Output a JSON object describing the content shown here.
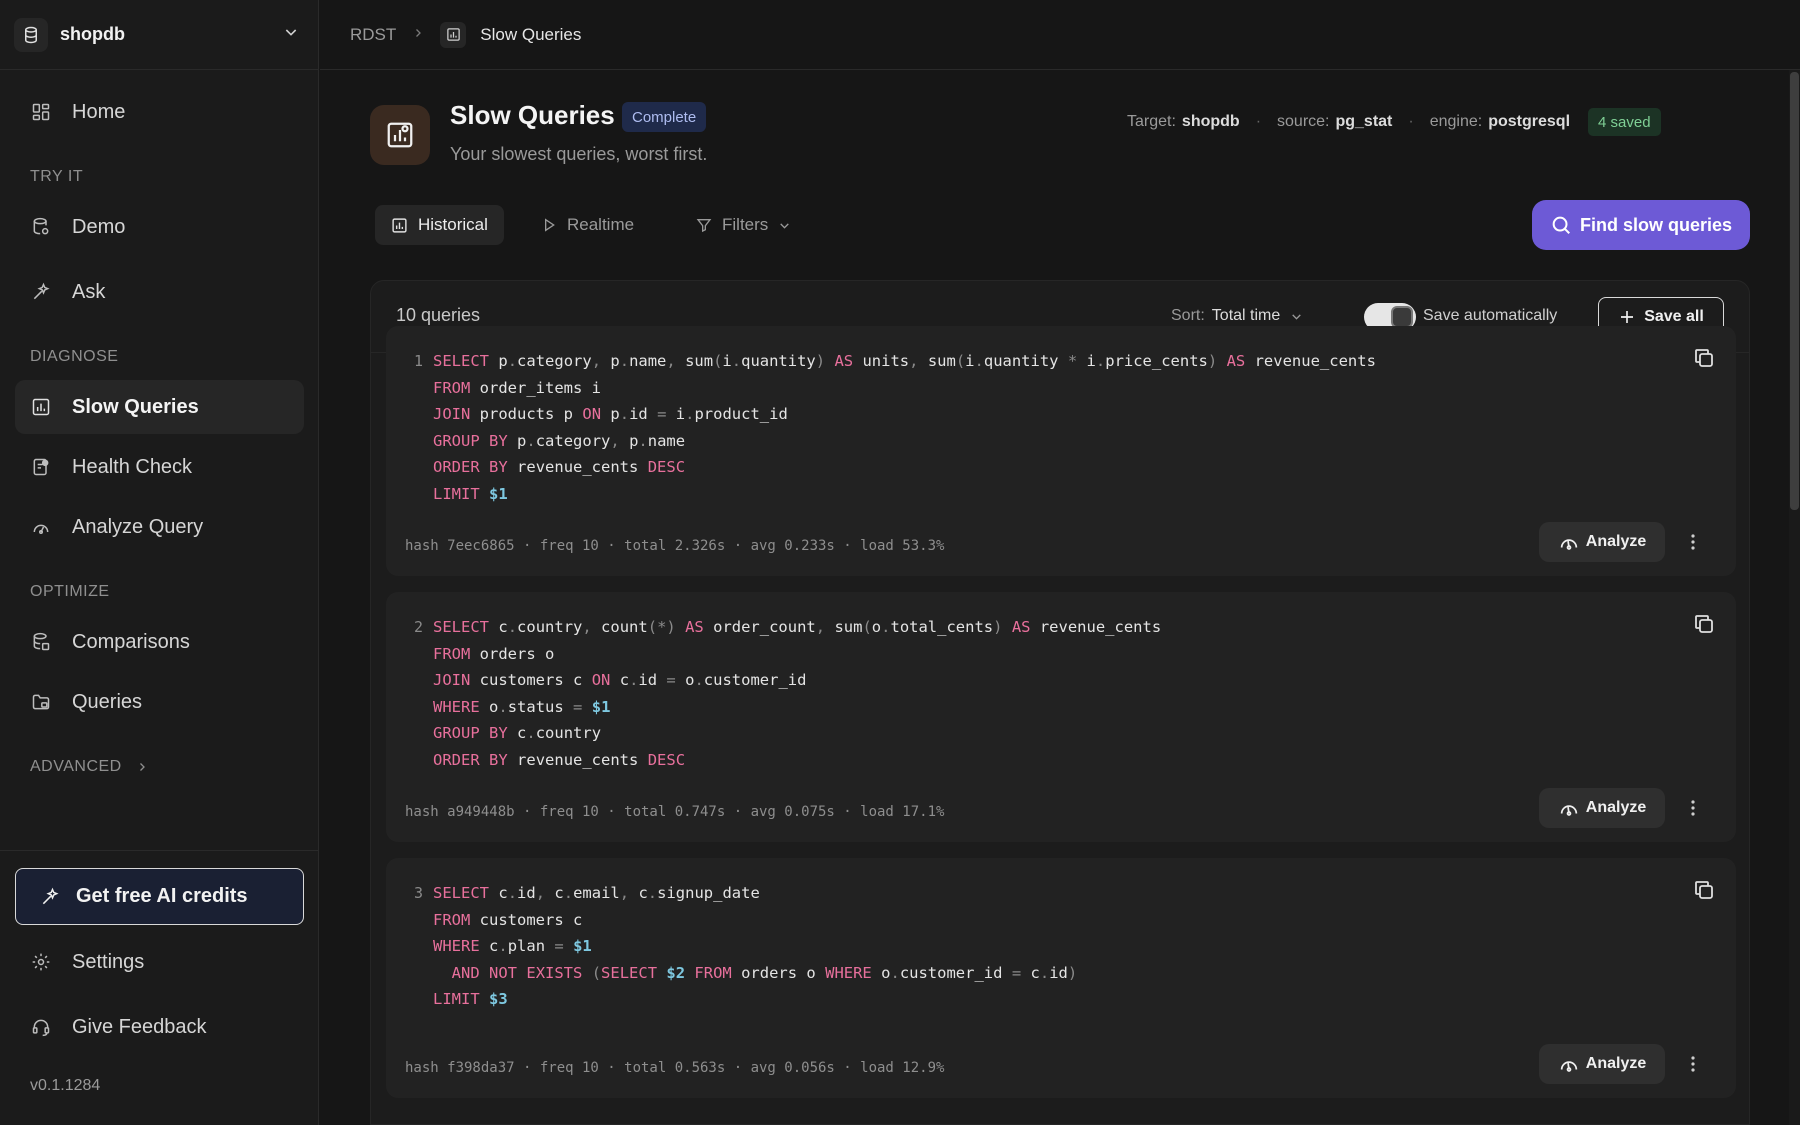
{
  "sidebar": {
    "database": "shopdb",
    "items": {
      "home": "Home",
      "demo": "Demo",
      "ask": "Ask",
      "slow_queries": "Slow Queries",
      "health_check": "Health Check",
      "analyze_query": "Analyze Query",
      "comparisons": "Comparisons",
      "queries": "Queries",
      "settings": "Settings",
      "give_feedback": "Give Feedback"
    },
    "sections": {
      "try_it": "TRY IT",
      "diagnose": "DIAGNOSE",
      "optimize": "OPTIMIZE",
      "advanced": "ADVANCED"
    },
    "credits_button": "Get free AI credits",
    "version": "v0.1.1284"
  },
  "breadcrumb": {
    "root": "RDST",
    "current": "Slow Queries"
  },
  "header": {
    "title": "Slow Queries",
    "status": "Complete",
    "subtitle": "Your slowest queries, worst first.",
    "target_label": "Target:",
    "target_value": "shopdb",
    "source_label": "source:",
    "source_value": "pg_stat",
    "engine_label": "engine:",
    "engine_value": "postgresql",
    "saved_badge": "4 saved"
  },
  "tabs": {
    "historical": "Historical",
    "realtime": "Realtime",
    "filters": "Filters"
  },
  "find_button": "Find slow queries",
  "results": {
    "count": "10 queries",
    "sort_label": "Sort:",
    "sort_value": "Total time",
    "auto_save_label": "Save automatically",
    "auto_save_on": true,
    "save_all": "Save all"
  },
  "queries": [
    {
      "number": "1",
      "sql": [
        "SELECT p.category, p.name, sum(i.quantity) AS units, sum(i.quantity * i.price_cents) AS revenue_cents",
        "FROM order_items i",
        "JOIN products p ON p.id = i.product_id",
        "GROUP BY p.category, p.name",
        "ORDER BY revenue_cents DESC",
        "LIMIT $1"
      ],
      "stats": "hash 7eec6865 · freq 10 · total 2.326s · avg 0.233s · load 53.3%",
      "analyze": "Analyze"
    },
    {
      "number": "2",
      "sql": [
        "SELECT c.country, count(*) AS order_count, sum(o.total_cents) AS revenue_cents",
        "FROM orders o",
        "JOIN customers c ON c.id = o.customer_id",
        "WHERE o.status = $1",
        "GROUP BY c.country",
        "ORDER BY revenue_cents DESC"
      ],
      "stats": "hash a949448b · freq 10 · total 0.747s · avg 0.075s · load 17.1%",
      "analyze": "Analyze"
    },
    {
      "number": "3",
      "sql": [
        "SELECT c.id, c.email, c.signup_date",
        "FROM customers c",
        "WHERE c.plan = $1",
        "  AND NOT EXISTS (SELECT $2 FROM orders o WHERE o.customer_id = c.id)",
        "LIMIT $3"
      ],
      "stats": "hash f398da37 · freq 10 · total 0.563s · avg 0.056s · load 12.9%",
      "analyze": "Analyze"
    }
  ],
  "colors": {
    "accent": "#6d5ad6",
    "sql_keyword": "#e8709c",
    "sql_param": "#7ec8e0",
    "status_badge": "#aebcf0",
    "saved_badge": "#7fcf95"
  }
}
